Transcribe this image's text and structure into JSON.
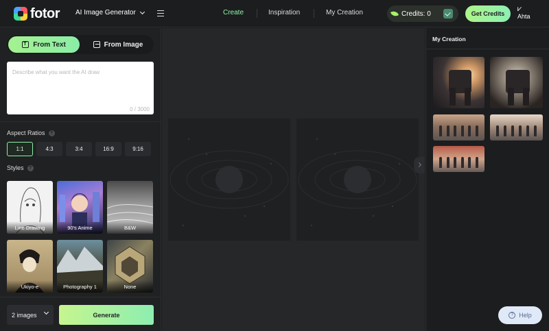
{
  "app": {
    "logo_text": "fotor",
    "generator_label": "AI Image Generator"
  },
  "nav": {
    "create": "Create",
    "inspiration": "Inspiration",
    "my_creation": "My Creation"
  },
  "credits": {
    "label": "Credits:",
    "value": "0",
    "get_credits": "Get Credits"
  },
  "user": {
    "avatar_text": "Ahta"
  },
  "tabs": {
    "from_text": "From Text",
    "from_image": "From Image"
  },
  "prompt": {
    "placeholder": "Describe what you want the AI draw",
    "counter": "0 / 3000"
  },
  "aspect": {
    "title": "Aspect Ratios",
    "options": [
      "1:1",
      "4:3",
      "3:4",
      "16:9",
      "9:16"
    ],
    "selected": "1:1"
  },
  "styles": {
    "title": "Styles",
    "items": [
      "Line Drawing",
      "90's Anime",
      "B&W",
      "Ukiyo-e",
      "Photography 1",
      "None"
    ]
  },
  "footer": {
    "image_count": "2 images",
    "generate": "Generate"
  },
  "right_panel": {
    "title": "My Creation"
  },
  "help": {
    "label": "Help"
  },
  "colors": {
    "accent": "#8ef3a8",
    "background": "#1c1d1f"
  }
}
